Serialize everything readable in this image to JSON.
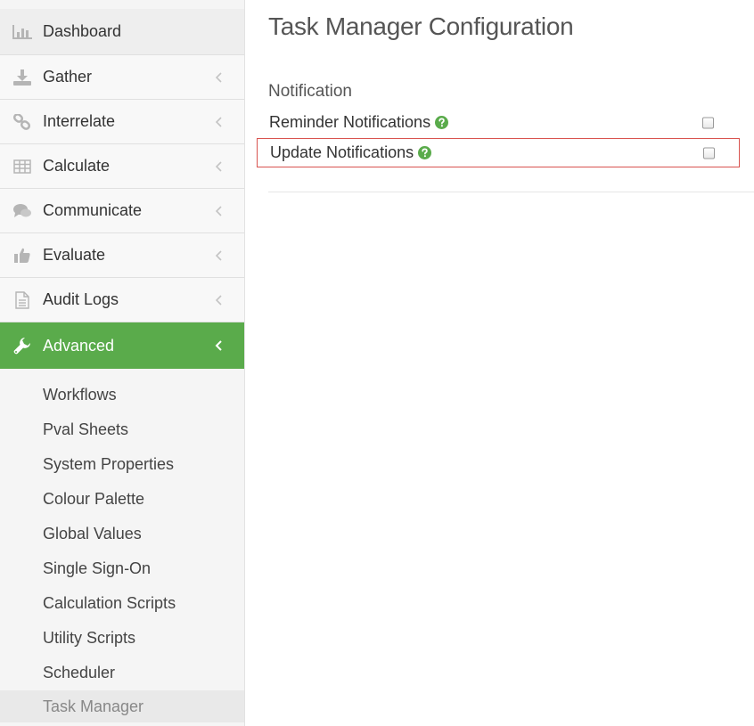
{
  "sidebar": {
    "items": [
      {
        "label": "Dashboard",
        "icon": "bar-chart-icon"
      },
      {
        "label": "Gather",
        "icon": "download-icon"
      },
      {
        "label": "Interrelate",
        "icon": "link-icon"
      },
      {
        "label": "Calculate",
        "icon": "table-icon"
      },
      {
        "label": "Communicate",
        "icon": "comments-icon"
      },
      {
        "label": "Evaluate",
        "icon": "thumbs-up-icon"
      },
      {
        "label": "Audit Logs",
        "icon": "document-icon"
      },
      {
        "label": "Advanced",
        "icon": "wrench-icon"
      }
    ],
    "submenu": [
      {
        "label": "Workflows"
      },
      {
        "label": "Pval Sheets"
      },
      {
        "label": "System Properties"
      },
      {
        "label": "Colour Palette"
      },
      {
        "label": "Global Values"
      },
      {
        "label": "Single Sign-On"
      },
      {
        "label": "Calculation Scripts"
      },
      {
        "label": "Utility Scripts"
      },
      {
        "label": "Scheduler"
      },
      {
        "label": "Task Manager"
      }
    ]
  },
  "main": {
    "title": "Task Manager Configuration",
    "section_title": "Notification",
    "settings": [
      {
        "label": "Reminder Notifications",
        "checked": false
      },
      {
        "label": "Update Notifications",
        "checked": false
      }
    ]
  },
  "colors": {
    "accent": "#5aab4b",
    "highlight_border": "#d9534f",
    "help_icon": "#5aab4b"
  }
}
